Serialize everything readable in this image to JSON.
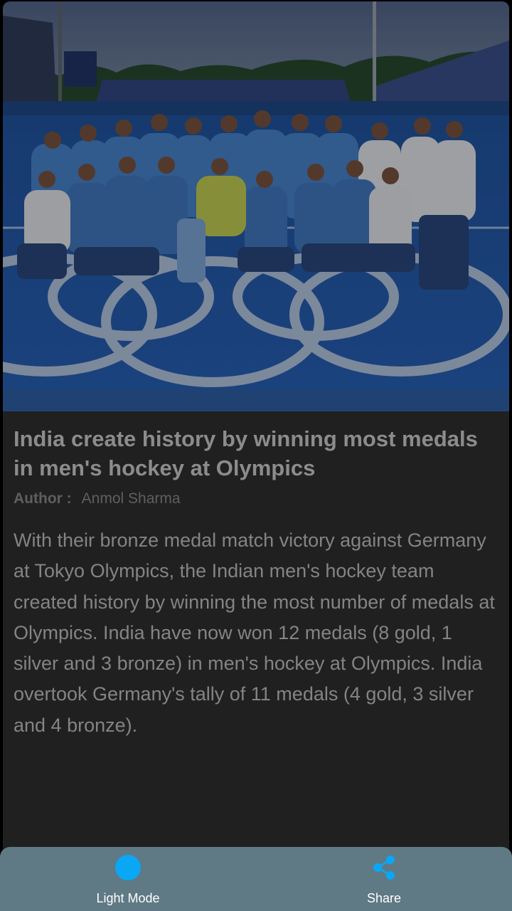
{
  "article": {
    "image_alt": "India men's hockey team celebrating on a blue pitch with Olympic rings",
    "title": "India create history by winning most medals in men's hockey at Olympics",
    "author_label": "Author :",
    "author_name": "Anmol Sharma",
    "body": "With their bronze medal match victory against Germany at Tokyo Olympics, the Indian men's hockey team created history by winning the most number of medals at Olympics. India have now won 12 medals (8 gold, 1 silver and 3 bronze) in men's hockey at Olympics. India overtook Germany's tally of 11 medals (4 gold, 3 silver and 4 bronze)."
  },
  "bottom_nav": {
    "light_mode": {
      "label": "Light Mode",
      "icon": "circle-icon",
      "color": "#0aa7f5"
    },
    "share": {
      "label": "Share",
      "icon": "share-icon",
      "color": "#0aa7f5"
    }
  },
  "colors": {
    "background": "#000000",
    "card": "#202020",
    "bottom_bar": "#5f7985",
    "accent": "#0aa7f5"
  }
}
